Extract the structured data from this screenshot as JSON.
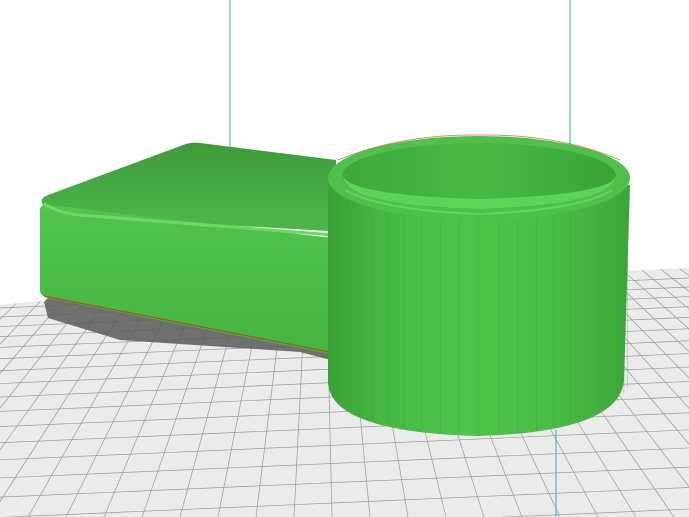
{
  "viewport": {
    "background": "#ffffff",
    "bed": {
      "fill": "#ebebeb",
      "grid_color": "#9a9a9a",
      "grid_visible": true
    },
    "guide_lines": {
      "color": "#4bb8d8",
      "count": 2
    },
    "model": {
      "color": "#4fc04a",
      "shape": "arm with hollow cylinder",
      "parts": [
        "arm-block",
        "cylinder-cup"
      ]
    },
    "shadow_color": "#5a5a5a"
  }
}
